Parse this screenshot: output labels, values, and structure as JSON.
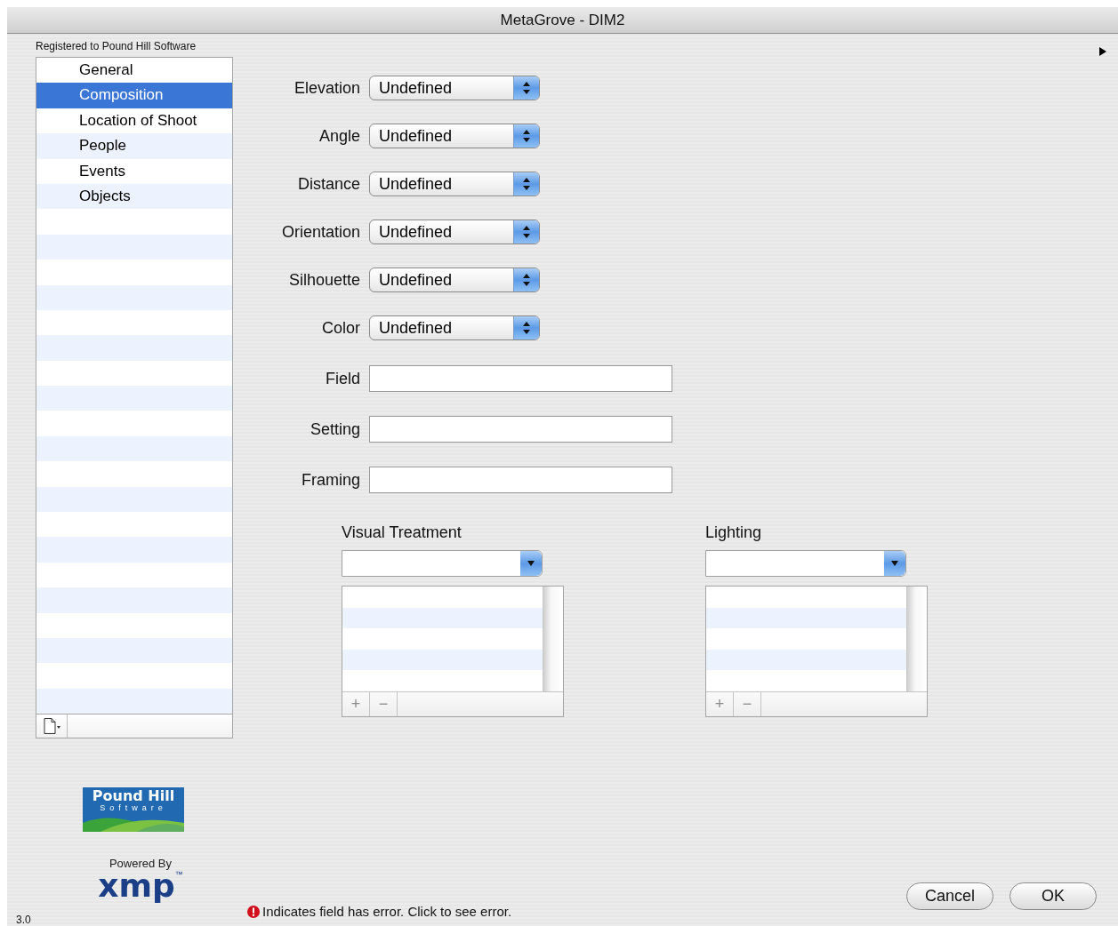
{
  "window": {
    "title": "MetaGrove - DIM2"
  },
  "registration": "Registered to Pound Hill Software",
  "categories": [
    {
      "label": "General",
      "selected": false
    },
    {
      "label": "Composition",
      "selected": true
    },
    {
      "label": "Location of Shoot",
      "selected": false
    },
    {
      "label": "People",
      "selected": false
    },
    {
      "label": "Events",
      "selected": false
    },
    {
      "label": "Objects",
      "selected": false
    }
  ],
  "popups": [
    {
      "label": "Elevation",
      "value": "Undefined"
    },
    {
      "label": "Angle",
      "value": "Undefined"
    },
    {
      "label": "Distance",
      "value": "Undefined"
    },
    {
      "label": "Orientation",
      "value": "Undefined"
    },
    {
      "label": "Silhouette",
      "value": "Undefined"
    },
    {
      "label": "Color",
      "value": "Undefined"
    }
  ],
  "text_fields": [
    {
      "label": "Field"
    },
    {
      "label": "Setting"
    },
    {
      "label": "Framing"
    }
  ],
  "lists": [
    {
      "title": "Visual Treatment",
      "add_button": "+",
      "remove_button": "−"
    },
    {
      "title": "Lighting",
      "add_button": "+",
      "remove_button": "−"
    }
  ],
  "logo": {
    "name": "Pound Hill",
    "tagline": "Software"
  },
  "powered_by": {
    "caption": "Powered By",
    "brand": "xmp",
    "mark": "™"
  },
  "version": "3.0",
  "error_note": "Indicates field has error. Click to see error.",
  "buttons": [
    "Cancel",
    "OK"
  ]
}
